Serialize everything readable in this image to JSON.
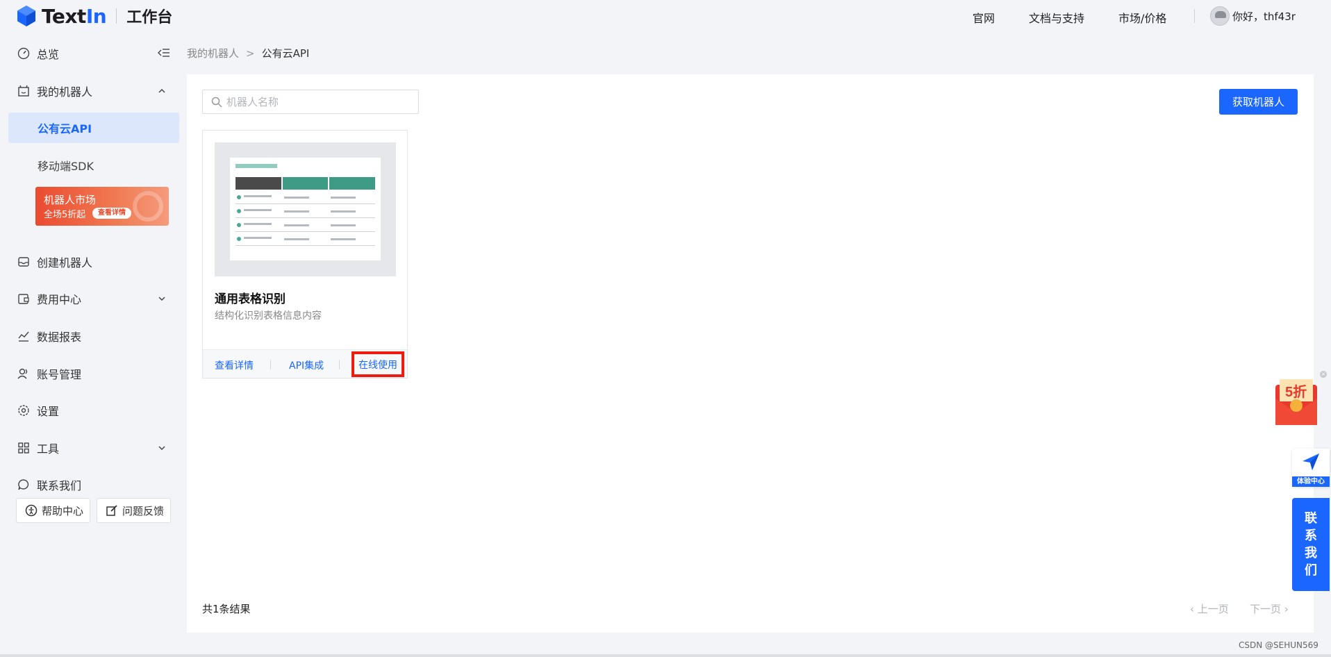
{
  "header": {
    "logo_text_main": "Text",
    "logo_text_accent": "In",
    "workspace_title": "工作台",
    "nav": {
      "official": "官网",
      "docs": "文档与支持",
      "market": "市场/价格"
    },
    "greeting": "你好，thf43r"
  },
  "sidebar": {
    "overview": "总览",
    "my_robots": "我的机器人",
    "public_api": "公有云API",
    "mobile_sdk": "移动端SDK",
    "promo": {
      "title": "机器人市场",
      "subtitle": "全场5折起",
      "button": "查看详情"
    },
    "create_robot": "创建机器人",
    "billing": "费用中心",
    "reports": "数据报表",
    "accounts": "账号管理",
    "settings": "设置",
    "tools": "工具",
    "contact": "联系我们",
    "help_center": "帮助中心",
    "feedback": "问题反馈"
  },
  "breadcrumb": {
    "parent": "我的机器人",
    "separator": ">",
    "current": "公有云API"
  },
  "main": {
    "search_placeholder": "机器人名称",
    "get_robot_button": "获取机器人",
    "card": {
      "title": "通用表格识别",
      "description": "结构化识别表格信息内容",
      "view_details": "查看详情",
      "api_integration": "API集成",
      "online_use": "在线使用"
    },
    "result_count": "共1条结果",
    "prev_page": "上一页",
    "next_page": "下一页"
  },
  "floating": {
    "discount": "5折",
    "experience_center": "体验中心",
    "contact_chars": [
      "联",
      "系",
      "我",
      "们"
    ]
  },
  "watermark": "CSDN @SEHUN569",
  "colors": {
    "accent": "#1a66ff",
    "highlight_box": "#ee1c0e",
    "promo": "#ea4b31"
  }
}
